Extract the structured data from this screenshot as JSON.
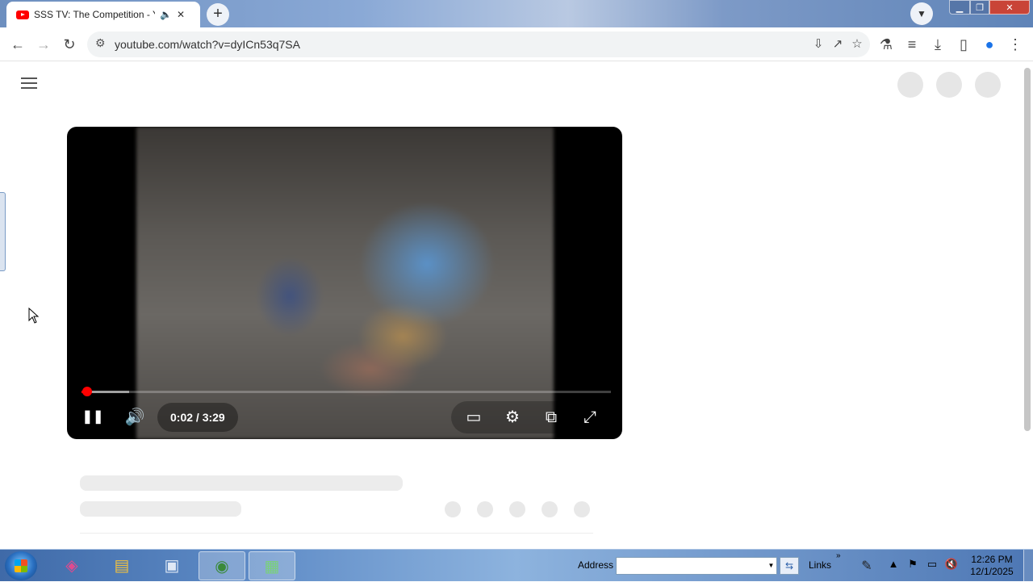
{
  "browser": {
    "tab_title": "SSS TV: The Competition - YouTube",
    "url": "youtube.com/watch?v=dyICn53q7SA",
    "new_tab_symbol": "+",
    "close_symbol": "✕"
  },
  "player": {
    "time_display": "0:02 / 3:29",
    "played_fraction": 0.01,
    "buffered_fraction": 0.09,
    "is_playing": true
  },
  "taskbar": {
    "address_label": "Address",
    "address_value": "",
    "links_label": "Links",
    "links_chevron": "»",
    "clock_time": "12:26 PM",
    "clock_date": "12/1/2025"
  },
  "icons": {
    "pause": "❚❚",
    "volume": "🔊",
    "subtitles": "▭",
    "settings": "⚙",
    "theater": "⧉",
    "fullscreen": "⤢"
  },
  "colors": {
    "accent_red": "#ff0000",
    "taskbar_blue": "#5f8cc7"
  }
}
